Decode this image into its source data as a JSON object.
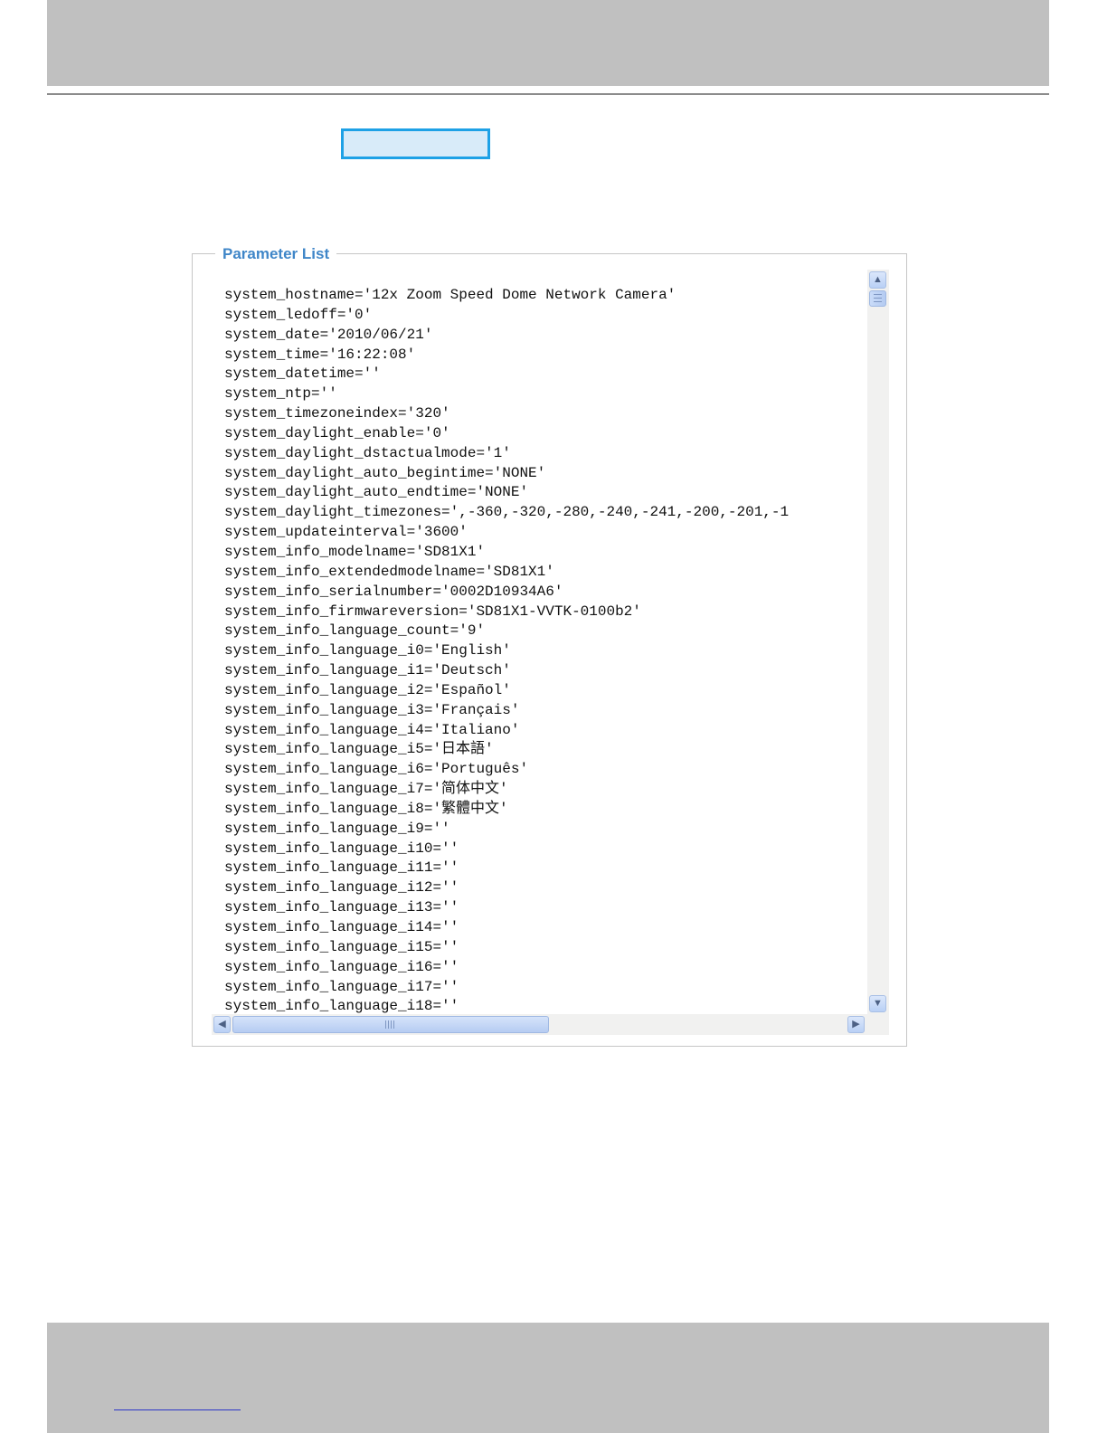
{
  "parameter_list": {
    "legend": "Parameter List",
    "lines": [
      "system_hostname='12x Zoom Speed Dome Network Camera'",
      "system_ledoff='0'",
      "system_date='2010/06/21'",
      "system_time='16:22:08'",
      "system_datetime=''",
      "system_ntp=''",
      "system_timezoneindex='320'",
      "system_daylight_enable='0'",
      "system_daylight_dstactualmode='1'",
      "system_daylight_auto_begintime='NONE'",
      "system_daylight_auto_endtime='NONE'",
      "system_daylight_timezones=',-360,-320,-280,-240,-241,-200,-201,-1",
      "system_updateinterval='3600'",
      "system_info_modelname='SD81X1'",
      "system_info_extendedmodelname='SD81X1'",
      "system_info_serialnumber='0002D10934A6'",
      "system_info_firmwareversion='SD81X1-VVTK-0100b2'",
      "system_info_language_count='9'",
      "system_info_language_i0='English'",
      "system_info_language_i1='Deutsch'",
      "system_info_language_i2='Español'",
      "system_info_language_i3='Français'",
      "system_info_language_i4='Italiano'",
      "system_info_language_i5='日本語'",
      "system_info_language_i6='Português'",
      "system_info_language_i7='简体中文'",
      "system_info_language_i8='繁體中文'",
      "system_info_language_i9=''",
      "system_info_language_i10=''",
      "system_info_language_i11=''",
      "system_info_language_i12=''",
      "system_info_language_i13=''",
      "system_info_language_i14=''",
      "system_info_language_i15=''",
      "system_info_language_i16=''",
      "system_info_language_i17=''",
      "system_info_language_i18=''"
    ]
  },
  "scrollbars": {
    "up_icon": "▲",
    "down_icon": "▼",
    "left_icon": "◀",
    "right_icon": "▶"
  },
  "colors": {
    "legend": "#3f86c8",
    "highlight_border": "#1ea1e6"
  }
}
